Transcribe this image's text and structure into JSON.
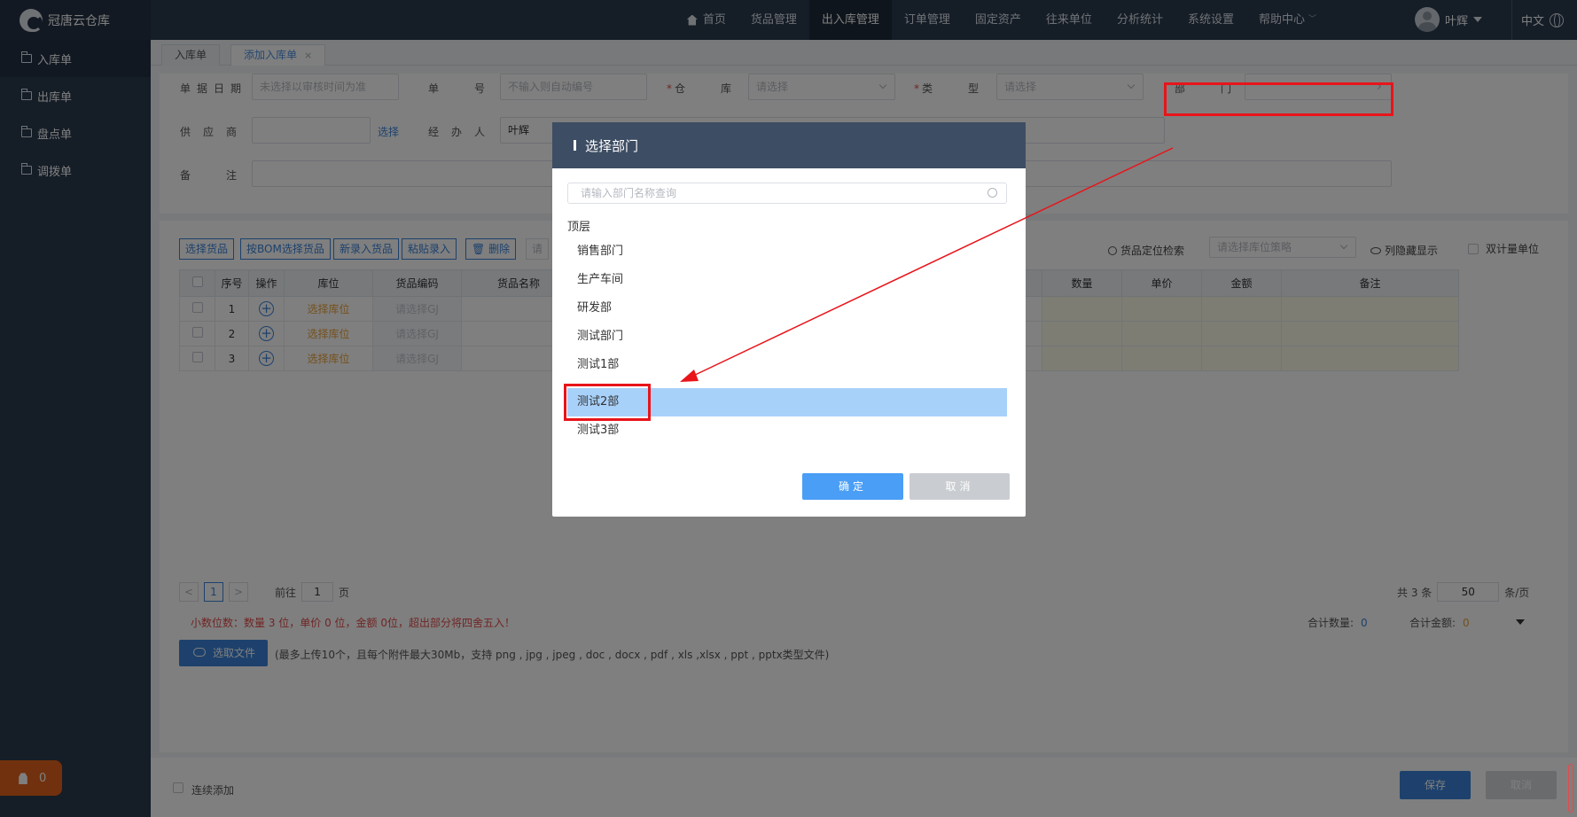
{
  "brand": {
    "name": "冠唐云仓库"
  },
  "nav": [
    {
      "label": "首页",
      "icon": "home-icon"
    },
    {
      "label": "货品管理"
    },
    {
      "label": "出入库管理",
      "active": true
    },
    {
      "label": "订单管理"
    },
    {
      "label": "固定资产"
    },
    {
      "label": "往来单位"
    },
    {
      "label": "分析统计"
    },
    {
      "label": "系统设置"
    },
    {
      "label": "帮助中心",
      "dropdown": true
    }
  ],
  "user": {
    "name": "叶辉",
    "lang": "中文"
  },
  "sidebar": {
    "items": [
      {
        "label": "入库单"
      },
      {
        "label": "出库单"
      },
      {
        "label": "盘点单"
      },
      {
        "label": "调拨单"
      }
    ]
  },
  "alarm": {
    "count": "0"
  },
  "tabs": [
    {
      "label": "入库单"
    },
    {
      "label": "添加入库单",
      "close": "×"
    }
  ],
  "form": {
    "date_label": "单据日期",
    "date_placeholder": "未选择以审核时间为准",
    "no_label": "单号",
    "no_placeholder": "不输入则自动编号",
    "warehouse_label": "仓库",
    "warehouse_placeholder": "请选择",
    "type_label": "类型",
    "type_placeholder": "请选择",
    "dept_label": "部门",
    "supplier_label": "供应商",
    "supplier_select": "选择",
    "handler_label": "经办人",
    "handler_value": "叶辉",
    "remark_label": "备注",
    "required_mark": "*"
  },
  "toolbar": {
    "buttons": [
      "选择货品",
      "按BOM选择货品",
      "新录入货品",
      "粘贴录入"
    ],
    "delete": "删除",
    "request": "请",
    "locate": "货品定位检索",
    "strategy_placeholder": "请选择库位策略",
    "hidden_cols": "列隐藏显示",
    "dual_unit": "双计量单位"
  },
  "table": {
    "headers": [
      "序号",
      "操作",
      "库位",
      "货品编码",
      "货品名称",
      "数量",
      "单价",
      "金额",
      "备注"
    ],
    "rows": [
      {
        "no": "1",
        "location": "选择库位",
        "code": "请选择GJ"
      },
      {
        "no": "2",
        "location": "选择库位",
        "code": "请选择GJ"
      },
      {
        "no": "3",
        "location": "选择库位",
        "code": "请选择GJ"
      }
    ]
  },
  "pager": {
    "prev": "<",
    "page": "1",
    "next": ">",
    "goto": "前往",
    "goto_value": "1",
    "page_unit": "页",
    "total": "共 3 条",
    "size": "50",
    "size_unit": "条/页"
  },
  "notice": "小数位数：数量 3 位，单价 0 位，金额 0位，超出部分将四舍五入！",
  "totals": {
    "qty_label": "合计数量:",
    "qty": "0",
    "amount_label": "合计金额:",
    "amount": "0"
  },
  "upload": {
    "button": "选取文件",
    "hint": "(最多上传10个，且每个附件最大30Mb，支持 png , jpg , jpeg , doc , docx , pdf , xls ,xlsx , ppt , pptx类型文件)"
  },
  "footer": {
    "continue": "连续添加",
    "save": "保存",
    "cancel": "取消"
  },
  "modal": {
    "title": "选择部门",
    "search_placeholder": "请输入部门名称查询",
    "root": "顶层",
    "items": [
      "销售部门",
      "生产车间",
      "研发部",
      "测试部门",
      "测试1部",
      "测试2部",
      "测试3部"
    ],
    "selected": "测试2部",
    "ok": "确定",
    "cancel": "取消"
  },
  "colors": {
    "topbar": "#2b3a4e",
    "accent": "#3a83d8",
    "selected": "#a8d1fa",
    "annotation": "#e8141a"
  }
}
